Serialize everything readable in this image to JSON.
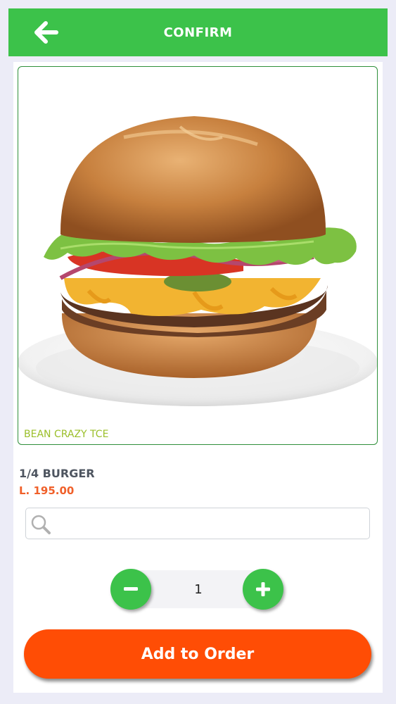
{
  "header": {
    "title": "CONFIRM",
    "back_icon": "arrow-left-icon"
  },
  "product": {
    "image_icon": "burger-image",
    "brand": "BEAN CRAZY TCE",
    "name": "1/4 BURGER",
    "price": "L. 195.00"
  },
  "search": {
    "icon": "search-icon",
    "value": "",
    "placeholder": ""
  },
  "quantity": {
    "value": "1",
    "decrement_icon": "minus-icon",
    "increment_icon": "plus-icon"
  },
  "actions": {
    "add_label": "Add to Order"
  },
  "colors": {
    "header": "#3cc24a",
    "accent_button": "#ff4d05",
    "price": "#f0602a",
    "brand_caption": "#9bbf2a",
    "page_background": "#ececf7"
  }
}
